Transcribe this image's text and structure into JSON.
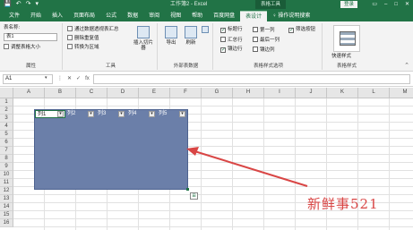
{
  "titlebar": {
    "quick_access": [
      "💾",
      "↶",
      "↷",
      "▾"
    ],
    "title": "工作簿2 - Excel",
    "context_tool": "表格工具",
    "login": "登录",
    "window_buttons": [
      "▭",
      "–",
      "□",
      "✕"
    ]
  },
  "tabs": [
    "文件",
    "开始",
    "插入",
    "页面布局",
    "公式",
    "数据",
    "审阅",
    "视图",
    "帮助",
    "百度网盘",
    "表设计"
  ],
  "active_tab": "表设计",
  "tell_me": "♀ 操作说明搜索",
  "ribbon": {
    "properties": {
      "table_name_label": "表名称:",
      "table_name_value": "表1",
      "resize_label": "调整表格大小",
      "group_label": "属性"
    },
    "tools": {
      "summarize": "通过数据透视表汇总",
      "remove_duplicates": "删除重复值",
      "convert_range": "转换为区域",
      "insert_slicer": "插入切片器",
      "group_label": "工具"
    },
    "external": {
      "export": "导出",
      "refresh": "刷新",
      "group_label": "外部表数据"
    },
    "style_options": {
      "header_row": "标题行",
      "first_column": "第一列",
      "filter_button": "筛选按钮",
      "total_row": "汇总行",
      "last_column": "最后一列",
      "banded_rows": "镶边行",
      "banded_columns": "镶边列",
      "group_label": "表格样式选项"
    },
    "table_styles": {
      "quick_styles": "快速样式",
      "group_label": "表格样式"
    }
  },
  "formula_bar": {
    "cell_ref": "A1",
    "icons": [
      "⋮",
      "✕",
      "✓",
      "fx"
    ]
  },
  "grid": {
    "columns": [
      "A",
      "B",
      "C",
      "D",
      "E",
      "F",
      "G",
      "H",
      "I",
      "J",
      "K",
      "L",
      "M"
    ],
    "rows": [
      "1",
      "2",
      "3",
      "4",
      "5",
      "6",
      "7",
      "8",
      "9",
      "10",
      "11",
      "12",
      "13",
      "14",
      "15",
      "16"
    ],
    "table_headers": [
      "列1",
      "列2",
      "列3",
      "列4",
      "列5"
    ],
    "filter_arrow": "▾",
    "quick_analysis": "⊞"
  },
  "colors": {
    "excel_green": "#217346",
    "table_fill": "#6b7fa9",
    "annotation_red": "#d94645"
  },
  "watermark": "新鲜事521"
}
